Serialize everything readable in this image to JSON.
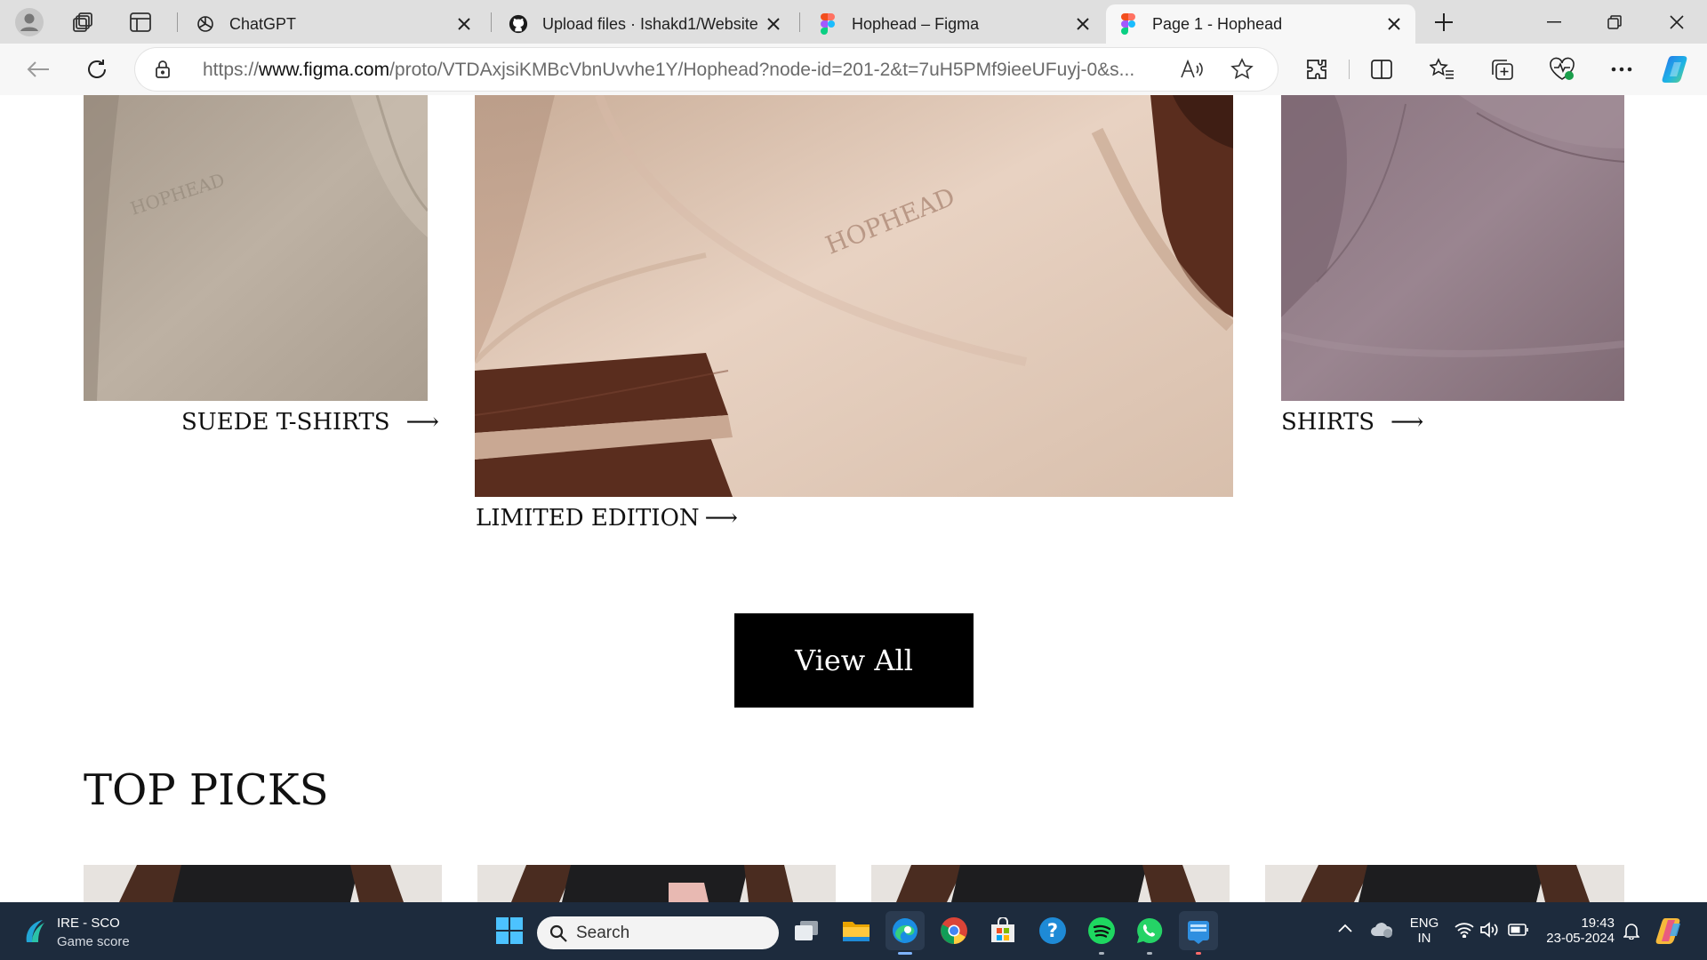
{
  "browser": {
    "tabs": [
      {
        "title": "ChatGPT",
        "favicon": "chatgpt-icon"
      },
      {
        "title": "Upload files · Ishakd1/Website",
        "favicon": "github-icon"
      },
      {
        "title": "Hophead – Figma",
        "favicon": "figma-icon"
      },
      {
        "title": "Page 1 - Hophead",
        "favicon": "figma-icon",
        "active": true
      }
    ],
    "url_prefix": "https://",
    "url_domain": "www.figma.com",
    "url_path": "/proto/VTDAxjsiKMBcVbnUvvhe1Y/Hophead?node-id=201-2&t=7uH5PMf9ieeUFuyj-0&s..."
  },
  "page": {
    "categories": {
      "suede": {
        "label": "SUEDE T-SHIRTS",
        "arrow": "⟶"
      },
      "limited": {
        "label": "LIMITED EDITION",
        "arrow": "⟶"
      },
      "shirts": {
        "label": "SHIRTS",
        "arrow": "⟶"
      }
    },
    "view_all_label": "View All",
    "top_picks_heading": "TOP PICKS",
    "embossed_brand": "HOPHEAD"
  },
  "taskbar": {
    "widget_line1": "IRE - SCO",
    "widget_line2": "Game score",
    "search_placeholder": "Search",
    "lang_line1": "ENG",
    "lang_line2": "IN",
    "time": "19:43",
    "date": "23-05-2024"
  },
  "colors": {
    "taskbar_bg": "#1d2b3d",
    "view_all_bg": "#000000",
    "suede_tee": "#b7aa9c",
    "limited_tee": "#e1c8b6",
    "limited_stripe": "#5a2d1e",
    "shirt": "#8e7882"
  }
}
